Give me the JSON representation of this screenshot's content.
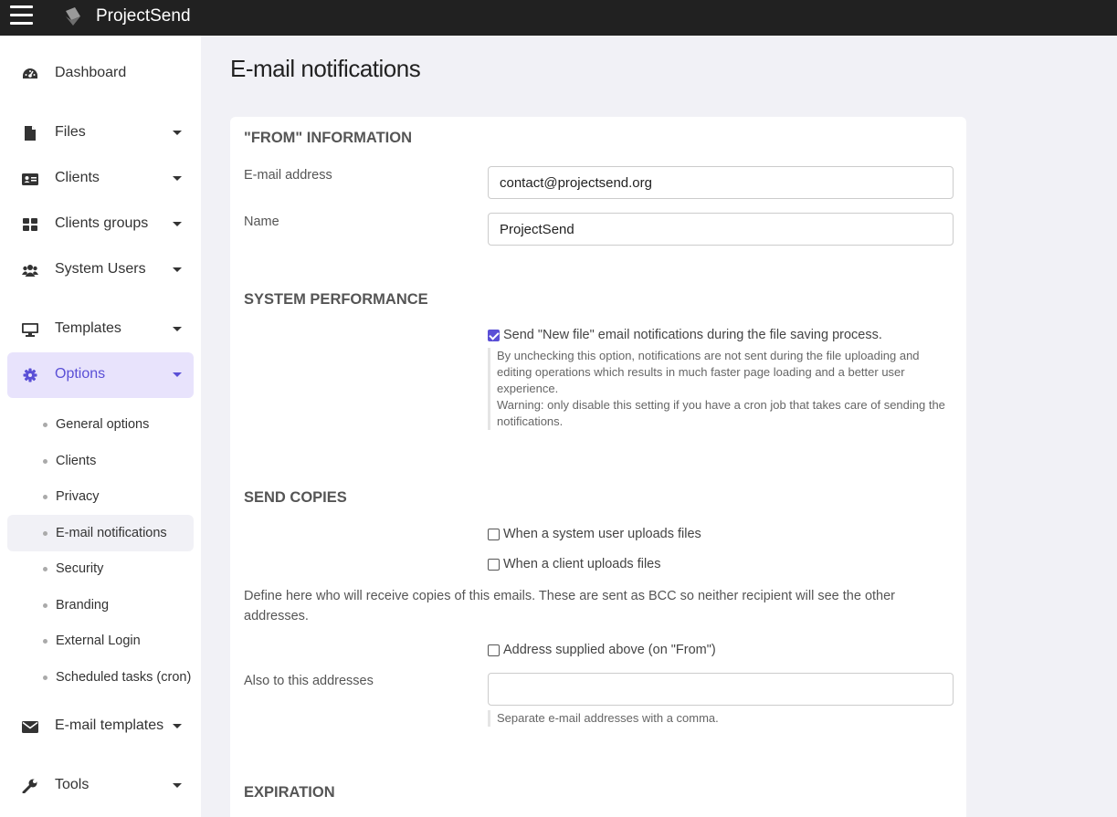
{
  "app": {
    "brand": "ProjectSend"
  },
  "sidebar": {
    "items": [
      {
        "label": "Dashboard",
        "icon": "dashboard-icon"
      },
      {
        "label": "Files",
        "icon": "file-icon"
      },
      {
        "label": "Clients",
        "icon": "id-card-icon"
      },
      {
        "label": "Clients groups",
        "icon": "grid-icon"
      },
      {
        "label": "System Users",
        "icon": "users-icon"
      },
      {
        "label": "Templates",
        "icon": "monitor-icon"
      },
      {
        "label": "Options",
        "icon": "gear-icon"
      },
      {
        "label": "E-mail templates",
        "icon": "envelope-icon"
      },
      {
        "label": "Tools",
        "icon": "wrench-icon"
      }
    ],
    "options_sub": [
      "General options",
      "Clients",
      "Privacy",
      "E-mail notifications",
      "Security",
      "Branding",
      "External Login",
      "Scheduled tasks (cron)"
    ],
    "active_item": "Options",
    "current_sub": "E-mail notifications"
  },
  "page": {
    "title": "E-mail notifications",
    "from": {
      "heading": "\"FROM\" INFORMATION",
      "email_label": "E-mail address",
      "email_value": "contact@projectsend.org",
      "name_label": "Name",
      "name_value": "ProjectSend"
    },
    "performance": {
      "heading": "SYSTEM PERFORMANCE",
      "checkbox_label": "Send \"New file\" email notifications during the file saving process.",
      "checked": true,
      "help_1": "By unchecking this option, notifications are not sent during the file uploading and editing operations which results in much faster page loading and a better user experience.",
      "help_2": "Warning: only disable this setting if you have a cron job that takes care of sending the notifications."
    },
    "copies": {
      "heading": "SEND COPIES",
      "system_user_label": "When a system user uploads files",
      "client_label": "When a client uploads files",
      "description": "Define here who will receive copies of this emails. These are sent as BCC so neither recipient will see the other addresses.",
      "address_above_label": "Address supplied above (on \"From\")",
      "also_label": "Also to this addresses",
      "also_value": "",
      "also_help": "Separate e-mail addresses with a comma."
    },
    "expiration": {
      "heading": "EXPIRATION"
    }
  }
}
